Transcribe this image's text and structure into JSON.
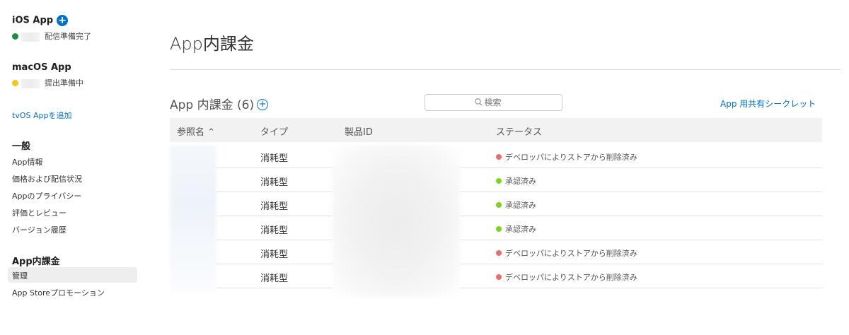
{
  "sidebar": {
    "ios": {
      "title": "iOS App",
      "status": "配信準備完了",
      "status_color": "#1e8e3e"
    },
    "macos": {
      "title": "macOS App",
      "status": "提出準備中",
      "status_color": "#f5c518"
    },
    "add_tvos": "tvOS Appを追加",
    "general": {
      "heading": "一般",
      "items": [
        "App情報",
        "価格および配信状況",
        "Appのプライバシー",
        "評価とレビュー",
        "バージョン履歴"
      ]
    },
    "iap": {
      "heading": "App内課金",
      "items": [
        "管理",
        "App Storeプロモーション"
      ]
    }
  },
  "main": {
    "title": "App内課金",
    "section_title": "App 内課金 (6)",
    "search_placeholder": "検索",
    "shared_secret": "App 用共有シークレット",
    "columns": [
      "参照名 ⌃",
      "タイプ",
      "製品ID",
      "ステータス"
    ],
    "rows": [
      {
        "type": "消耗型",
        "status": "デベロッパによりストアから削除済み",
        "status_color": "red"
      },
      {
        "type": "消耗型",
        "status": "承認済み",
        "status_color": "green"
      },
      {
        "type": "消耗型",
        "status": "承認済み",
        "status_color": "green"
      },
      {
        "type": "消耗型",
        "status": "承認済み",
        "status_color": "green"
      },
      {
        "type": "消耗型",
        "status": "デベロッパによりストアから削除済み",
        "status_color": "red"
      },
      {
        "type": "消耗型",
        "status": "デベロッパによりストアから削除済み",
        "status_color": "red"
      }
    ]
  },
  "colors": {
    "accent": "#0070c9",
    "status_red": "#ec6b6b",
    "status_green": "#7ed321"
  }
}
